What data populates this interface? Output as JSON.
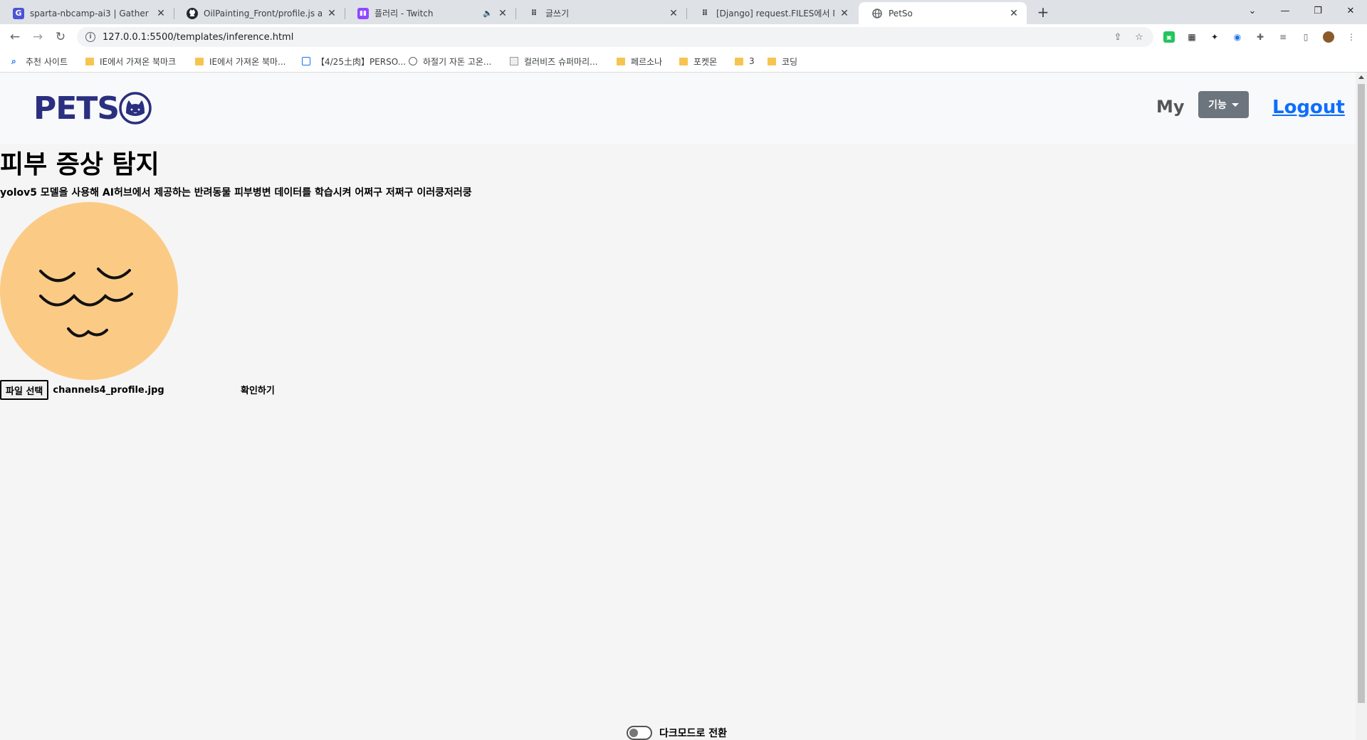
{
  "browser": {
    "tabs": [
      {
        "title": "sparta-nbcamp-ai3 | Gather",
        "icon": "gather-icon",
        "close": "✕"
      },
      {
        "title": "OilPainting_Front/profile.js at ma",
        "icon": "github-icon",
        "close": "✕"
      },
      {
        "title": "플러리 - Twitch",
        "icon": "twitch-icon",
        "close": "✕",
        "mute": "🔈"
      },
      {
        "title": "글쓰기",
        "icon": "velog-icon",
        "close": "✕"
      },
      {
        "title": "[Django] request.FILES에서 Multi",
        "icon": "velog-icon",
        "close": "✕"
      },
      {
        "title": "PetSo",
        "icon": "globe-icon",
        "close": "✕"
      }
    ],
    "new_tab": "+",
    "window_controls": {
      "tab_search": "⌄",
      "minimize": "—",
      "restore": "❐",
      "close": "✕"
    },
    "url": "127.0.0.1:5500/templates/inference.html",
    "bookmarks": [
      {
        "label": "추천 사이트",
        "icon": "search-icon"
      },
      {
        "label": "IE에서 가져온 북마크",
        "icon": "folder-icon"
      },
      {
        "label": "IE에서 가져온 북마...",
        "icon": "folder-icon"
      },
      {
        "label": "【4/25土肉】PERSO...",
        "icon": "calendar-icon"
      },
      {
        "label": "하절기 자돈 고온...",
        "icon": "globe-icon"
      },
      {
        "label": "컬러비즈 슈퍼마리...",
        "icon": "broken-image-icon"
      },
      {
        "label": "페르소나",
        "icon": "folder-icon"
      },
      {
        "label": "포켓몬",
        "icon": "folder-icon"
      },
      {
        "label": "3",
        "icon": "folder-icon"
      },
      {
        "label": "코딩",
        "icon": "folder-icon"
      }
    ]
  },
  "site": {
    "logo_text": "PETS",
    "nav": {
      "my": "My",
      "func": "기능",
      "logout": "Logout"
    }
  },
  "main": {
    "title": "피부 증상 탐지",
    "description": "yolov5 모델을 사용해 AI허브에서 제공하는 반려동물 피부병변 데이터를 학습시켜 어쩌구 저쩌구 이러쿵저러쿵",
    "file_button": "파일 선택",
    "file_name": "channels4_profile.jpg",
    "confirm": "확인하기",
    "dark_mode": "다크모드로 전환"
  },
  "colors": {
    "logo": "#2a2f7f",
    "preview_face": "#fbcb86",
    "func_button": "#6c757d",
    "logout_link": "#0d6efd"
  }
}
